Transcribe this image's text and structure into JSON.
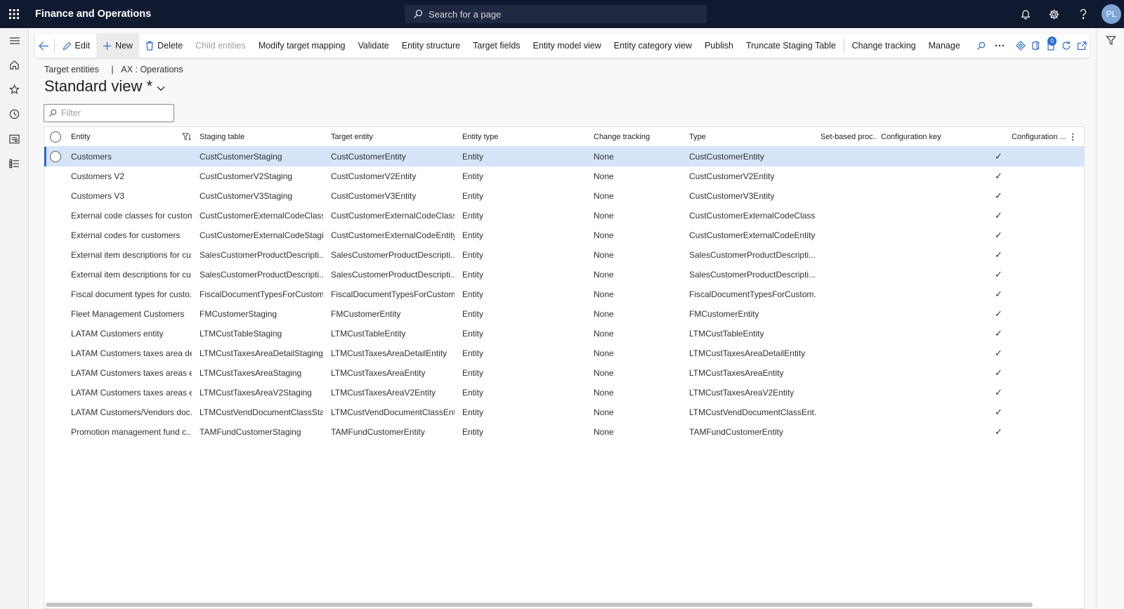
{
  "app": {
    "title": "Finance and Operations",
    "search_placeholder": "Search for a page",
    "avatar_initials": "PL",
    "notification_badge": "0"
  },
  "actionbar": {
    "edit": "Edit",
    "new": "New",
    "delete": "Delete",
    "child_entities": "Child entities",
    "modify_target_mapping": "Modify target mapping",
    "validate": "Validate",
    "entity_structure": "Entity structure",
    "target_fields": "Target fields",
    "entity_model_view": "Entity model view",
    "entity_category_view": "Entity category view",
    "publish": "Publish",
    "truncate_staging_table": "Truncate Staging Table",
    "change_tracking": "Change tracking",
    "manage": "Manage"
  },
  "breadcrumb": {
    "page": "Target entities",
    "separator": "|",
    "company": "AX : Operations"
  },
  "view": {
    "title": "Standard view *"
  },
  "filter": {
    "placeholder": "Filter"
  },
  "grid": {
    "columns": [
      "Entity",
      "Staging table",
      "Target entity",
      "Entity type",
      "Change tracking",
      "Type",
      "Set-based proc...",
      "Configuration key",
      "Configuration ..."
    ],
    "check_glyph": "✓",
    "rows": [
      [
        "Customers",
        "CustCustomerStaging",
        "CustCustomerEntity",
        "Entity",
        "None",
        "CustCustomerEntity"
      ],
      [
        "Customers V2",
        "CustCustomerV2Staging",
        "CustCustomerV2Entity",
        "Entity",
        "None",
        "CustCustomerV2Entity"
      ],
      [
        "Customers V3",
        "CustCustomerV3Staging",
        "CustCustomerV3Entity",
        "Entity",
        "None",
        "CustCustomerV3Entity"
      ],
      [
        "External code classes for custom...",
        "CustCustomerExternalCodeClass...",
        "CustCustomerExternalCodeClass...",
        "Entity",
        "None",
        "CustCustomerExternalCodeClass..."
      ],
      [
        "External codes for customers",
        "CustCustomerExternalCodeStagi...",
        "CustCustomerExternalCodeEntity",
        "Entity",
        "None",
        "CustCustomerExternalCodeEntity"
      ],
      [
        "External item descriptions for cu...",
        "SalesCustomerProductDescripti...",
        "SalesCustomerProductDescripti...",
        "Entity",
        "None",
        "SalesCustomerProductDescripti..."
      ],
      [
        "External item descriptions for cu...",
        "SalesCustomerProductDescripti...",
        "SalesCustomerProductDescripti...",
        "Entity",
        "None",
        "SalesCustomerProductDescripti..."
      ],
      [
        "Fiscal document types for custo...",
        "FiscalDocumentTypesForCustom...",
        "FiscalDocumentTypesForCustom...",
        "Entity",
        "None",
        "FiscalDocumentTypesForCustom..."
      ],
      [
        "Fleet Management Customers",
        "FMCustomerStaging",
        "FMCustomerEntity",
        "Entity",
        "None",
        "FMCustomerEntity"
      ],
      [
        "LATAM Customers entity",
        "LTMCustTableStaging",
        "LTMCustTableEntity",
        "Entity",
        "None",
        "LTMCustTableEntity"
      ],
      [
        "LATAM Customers taxes area de...",
        "LTMCustTaxesAreaDetailStaging",
        "LTMCustTaxesAreaDetailEntity",
        "Entity",
        "None",
        "LTMCustTaxesAreaDetailEntity"
      ],
      [
        "LATAM Customers taxes areas e...",
        "LTMCustTaxesAreaStaging",
        "LTMCustTaxesAreaEntity",
        "Entity",
        "None",
        "LTMCustTaxesAreaEntity"
      ],
      [
        "LATAM Customers taxes areas e...",
        "LTMCustTaxesAreaV2Staging",
        "LTMCustTaxesAreaV2Entity",
        "Entity",
        "None",
        "LTMCustTaxesAreaV2Entity"
      ],
      [
        "LATAM Customers/Vendors doc...",
        "LTMCustVendDocumentClassSta...",
        "LTMCustVendDocumentClassEnt...",
        "Entity",
        "None",
        "LTMCustVendDocumentClassEnt..."
      ],
      [
        "Promotion management fund c...",
        "TAMFundCustomerStaging",
        "TAMFundCustomerEntity",
        "Entity",
        "None",
        "TAMFundCustomerEntity"
      ]
    ]
  },
  "colors": {
    "topbar": "#0f1a31",
    "selected_row": "#d6e4f7",
    "accent": "#2a6ccf"
  }
}
